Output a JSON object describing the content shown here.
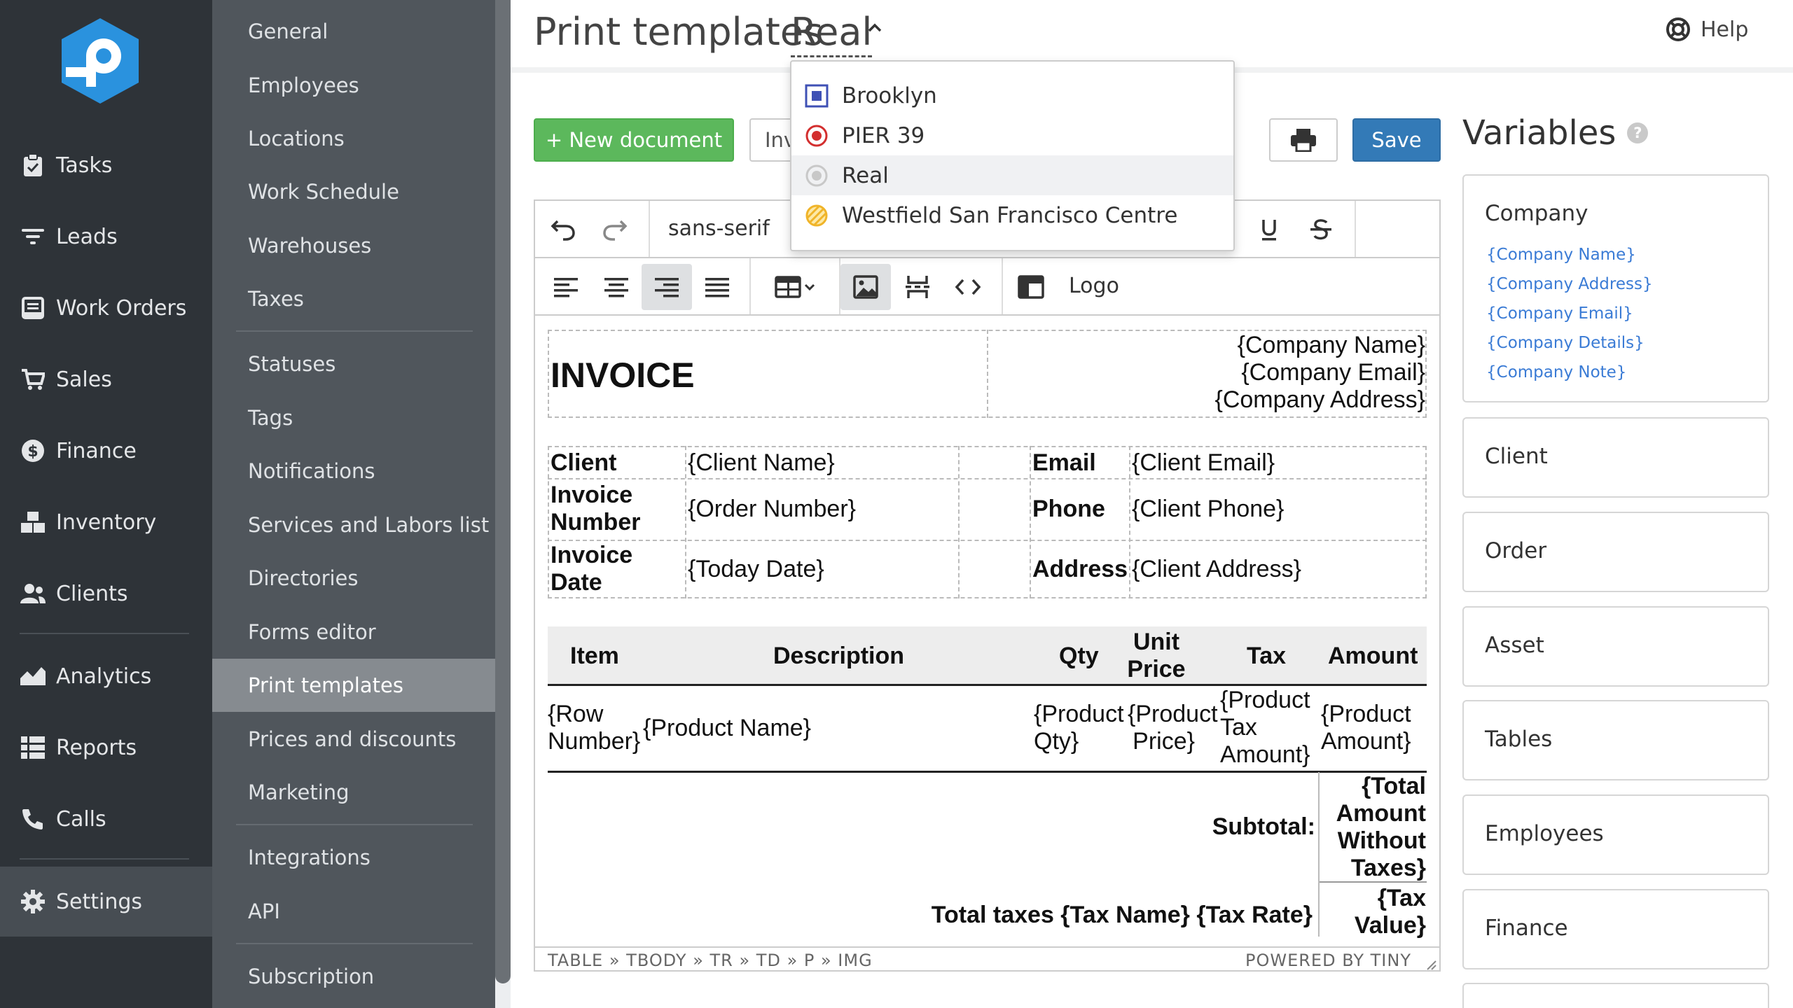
{
  "nav": {
    "items": [
      {
        "label": "Tasks",
        "icon": "clipboard-icon"
      },
      {
        "label": "Leads",
        "icon": "filter-icon"
      },
      {
        "label": "Work Orders",
        "icon": "inbox-icon"
      },
      {
        "label": "Sales",
        "icon": "cart-icon"
      },
      {
        "label": "Finance",
        "icon": "dollar-icon"
      },
      {
        "label": "Inventory",
        "icon": "boxes-icon"
      },
      {
        "label": "Clients",
        "icon": "users-icon"
      },
      {
        "label": "Analytics",
        "icon": "chart-icon"
      },
      {
        "label": "Reports",
        "icon": "list-icon"
      },
      {
        "label": "Calls",
        "icon": "phone-icon"
      },
      {
        "label": "Settings",
        "icon": "gear-icon"
      }
    ],
    "active": "Settings"
  },
  "subnav": {
    "items": [
      {
        "label": "General"
      },
      {
        "label": "Employees"
      },
      {
        "label": "Locations"
      },
      {
        "label": "Work Schedule"
      },
      {
        "label": "Warehouses"
      },
      {
        "label": "Taxes"
      },
      {
        "label": "Statuses"
      },
      {
        "label": "Tags"
      },
      {
        "label": "Notifications"
      },
      {
        "label": "Services and Labors list"
      },
      {
        "label": "Directories"
      },
      {
        "label": "Forms editor"
      },
      {
        "label": "Print templates"
      },
      {
        "label": "Prices and discounts"
      },
      {
        "label": "Marketing"
      },
      {
        "label": "Integrations"
      },
      {
        "label": "API"
      },
      {
        "label": "Subscription"
      }
    ],
    "active": "Print templates"
  },
  "header": {
    "title": "Print templates",
    "location": "Real",
    "help": "Help"
  },
  "toolbar": {
    "new_document": "+ New document",
    "document_select": "Inv",
    "save": "Save"
  },
  "location_dropdown": {
    "options": [
      {
        "label": "Brooklyn",
        "icon": "square-icon",
        "color": "#3f51b5"
      },
      {
        "label": "PIER 39",
        "icon": "target-icon",
        "color": "#d32f2f"
      },
      {
        "label": "Real",
        "icon": "circle-icon",
        "color": "#c8c8c8"
      },
      {
        "label": "Westfield San Francisco Centre",
        "icon": "slashed-circle-icon",
        "color": "#f0b429"
      }
    ],
    "selected": "Real"
  },
  "editor": {
    "font": "sans-serif",
    "logo_label": "Logo",
    "status_path": "TABLE » TBODY » TR » TD » P » IMG",
    "powered_by": "POWERED BY TINY"
  },
  "document": {
    "invoice_title": "INVOICE",
    "company_name": "{Company Name}",
    "company_email": "{Company Email}",
    "company_address": "{Company Address}",
    "client_label": "Client",
    "client_value": "{Client Name}",
    "invoice_number_label_1": "Invoice",
    "invoice_number_label_2": "Number",
    "invoice_number_value": "{Order Number}",
    "invoice_date_label_1": "Invoice",
    "invoice_date_label_2": "Date",
    "invoice_date_value": "{Today Date}",
    "email_label": "Email",
    "email_value": "{Client Email}",
    "phone_label": "Phone",
    "phone_value": "{Client Phone}",
    "address_label": "Address",
    "address_value": "{Client Address}",
    "columns": {
      "item": "Item",
      "description": "Description",
      "qty": "Qty",
      "unit_price_1": "Unit",
      "unit_price_2": "Price",
      "tax": "Tax",
      "amount": "Amount"
    },
    "row": {
      "number_1": "{Row",
      "number_2": "Number}",
      "product_name": "{Product Name}",
      "qty_1": "{Product",
      "qty_2": "Qty}",
      "price_1": "{Product",
      "price_2": "Price}",
      "tax_1": "{Product",
      "tax_2": "Tax",
      "tax_3": "Amount}",
      "amount_1": "{Product",
      "amount_2": "Amount}"
    },
    "subtotal_label": "Subtotal:",
    "subtotal_1": "{Total",
    "subtotal_2": "Amount",
    "subtotal_3": "Without",
    "subtotal_4": "Taxes}",
    "total_taxes_label": "Total taxes {Tax Name} {Tax Rate}",
    "tax_value_1": "{Tax",
    "tax_value_2": "Value}"
  },
  "variables": {
    "title": "Variables",
    "help_mark": "?",
    "groups": [
      {
        "label": "Company",
        "items": [
          "{Company Name}",
          "{Company Address}",
          "{Company Email}",
          "{Company Details}",
          "{Company Note}"
        ]
      },
      {
        "label": "Client"
      },
      {
        "label": "Order"
      },
      {
        "label": "Asset"
      },
      {
        "label": "Tables"
      },
      {
        "label": "Employees"
      },
      {
        "label": "Finance"
      }
    ]
  }
}
